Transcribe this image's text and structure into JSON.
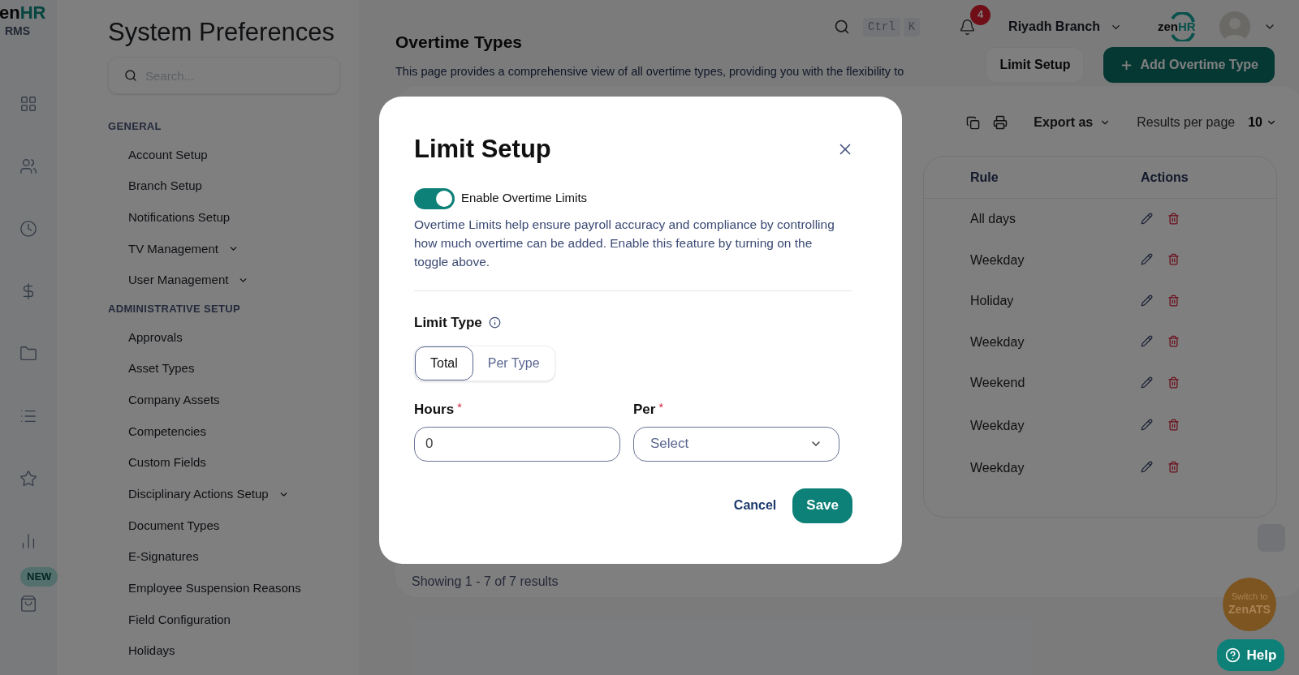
{
  "brand": {
    "prefix": "en",
    "suffix": "HR",
    "product": "RMS"
  },
  "rail": {
    "badge": "NEW"
  },
  "settings": {
    "title": "System Preferences",
    "search": {
      "placeholder": "Search..."
    },
    "sections": [
      {
        "label": "GENERAL",
        "items": [
          {
            "label": "Account Setup",
            "has_submenu": false
          },
          {
            "label": "Branch Setup",
            "has_submenu": false
          },
          {
            "label": "Notifications Setup",
            "has_submenu": false
          },
          {
            "label": "TV Management",
            "has_submenu": true
          },
          {
            "label": "User Management",
            "has_submenu": true
          }
        ]
      },
      {
        "label": "ADMINISTRATIVE SETUP",
        "items": [
          {
            "label": "Approvals",
            "has_submenu": false
          },
          {
            "label": "Asset Types",
            "has_submenu": false
          },
          {
            "label": "Company Assets",
            "has_submenu": false
          },
          {
            "label": "Competencies",
            "has_submenu": false
          },
          {
            "label": "Custom Fields",
            "has_submenu": false
          },
          {
            "label": "Disciplinary Actions Setup",
            "has_submenu": true
          },
          {
            "label": "Document Types",
            "has_submenu": false
          },
          {
            "label": "E-Signatures",
            "has_submenu": false
          },
          {
            "label": "Employee Suspension Reasons",
            "has_submenu": false
          },
          {
            "label": "Field Configuration",
            "has_submenu": false
          },
          {
            "label": "Holidays",
            "has_submenu": false
          }
        ]
      }
    ]
  },
  "header": {
    "shortcut": [
      "Ctrl",
      "K"
    ],
    "notifications": "4",
    "branch": "Riyadh Branch",
    "logo": {
      "prefix": "zen",
      "suffix": "HR"
    }
  },
  "page": {
    "title": "Overtime Types",
    "description": "This page provides a comprehensive view of all overtime types, providing you with the flexibility to",
    "buttons": [
      {
        "label": "Limit Setup",
        "kind": "secondary"
      },
      {
        "label": "Add Overtime Type",
        "kind": "primary"
      }
    ],
    "toolbar": {
      "export": "Export as",
      "results_label": "Results per page",
      "results_value": "10"
    },
    "table": {
      "columns": [
        "Rule",
        "Actions"
      ],
      "rows": [
        {
          "rule": "All days"
        },
        {
          "rule": "Weekday"
        },
        {
          "rule": "Holiday"
        },
        {
          "rule": "Weekday"
        },
        {
          "rule": "Weekend"
        },
        {
          "rule": "Weekday"
        },
        {
          "rule": "Weekday"
        }
      ]
    },
    "summary": "Showing 1 - 7 of 7 results"
  },
  "modal": {
    "title": "Limit Setup",
    "toggle": {
      "label": "Enable Overtime Limits",
      "on": true
    },
    "help": "Overtime Limits help ensure payroll accuracy and compliance by controlling how much overtime can be added. Enable this feature by turning on the toggle above.",
    "limit_type": {
      "label": "Limit Type",
      "options": [
        {
          "label": "Total",
          "selected": true
        },
        {
          "label": "Per Type",
          "selected": false
        }
      ]
    },
    "fields": [
      {
        "label": "Hours",
        "required_mark": "*",
        "kind": "input",
        "value": "0"
      },
      {
        "label": "Per",
        "required_mark": "*",
        "kind": "select",
        "placeholder": "Select"
      }
    ],
    "buttons": [
      {
        "label": "Cancel",
        "kind": "link"
      },
      {
        "label": "Save",
        "kind": "primary"
      }
    ]
  },
  "switch_promo": {
    "line1": "Switch to",
    "line2": "ZenATS"
  },
  "help_button": "Help"
}
